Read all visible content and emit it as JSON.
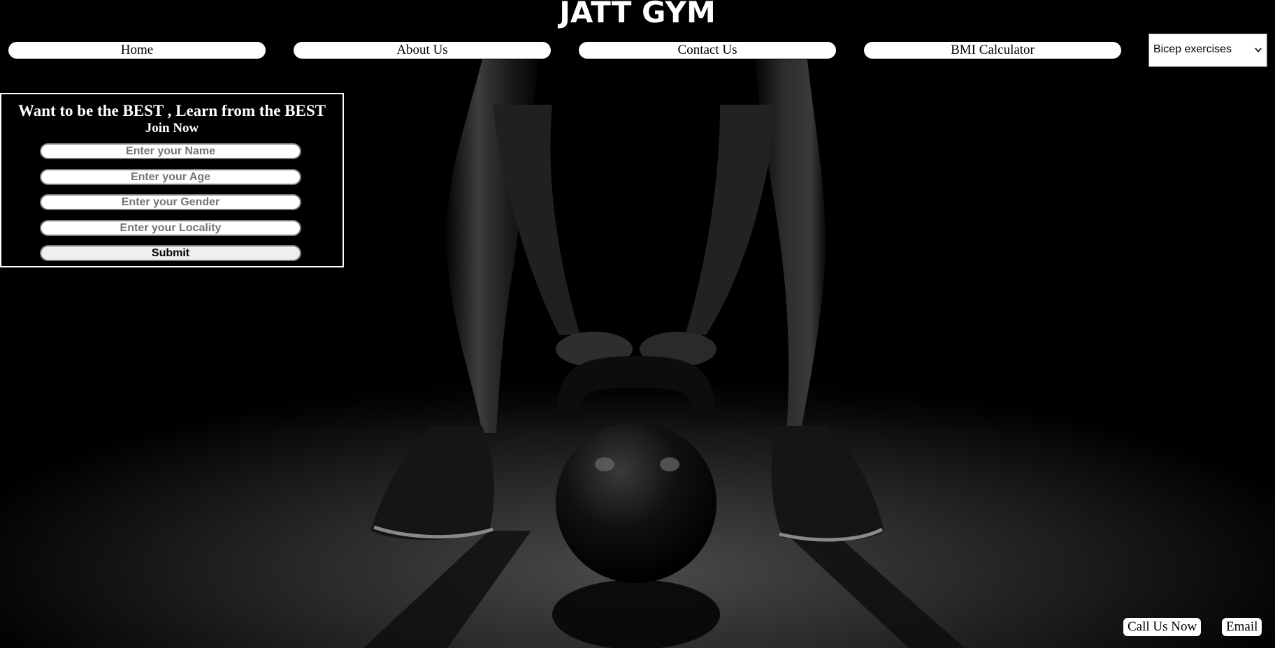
{
  "header": {
    "title": "JATT GYM"
  },
  "nav": {
    "items": [
      {
        "label": "Home"
      },
      {
        "label": "About Us"
      },
      {
        "label": "Contact Us"
      },
      {
        "label": "BMI Calculator"
      }
    ],
    "select": {
      "selected": "Bicep exercises",
      "icon": "chevron-down-icon"
    }
  },
  "form": {
    "heading": "Want to be the BEST , Learn from the BEST",
    "subheading": "Join Now",
    "fields": [
      {
        "placeholder": "Enter your Name",
        "value": ""
      },
      {
        "placeholder": "Enter your Age",
        "value": ""
      },
      {
        "placeholder": "Enter your Gender",
        "value": ""
      },
      {
        "placeholder": "Enter your Locality",
        "value": ""
      }
    ],
    "submit_label": "Submit"
  },
  "footer": {
    "call_label": "Call Us Now",
    "email_label": "Email"
  },
  "colors": {
    "background": "#000000",
    "text": "#ffffff",
    "button": "#ffffff"
  }
}
